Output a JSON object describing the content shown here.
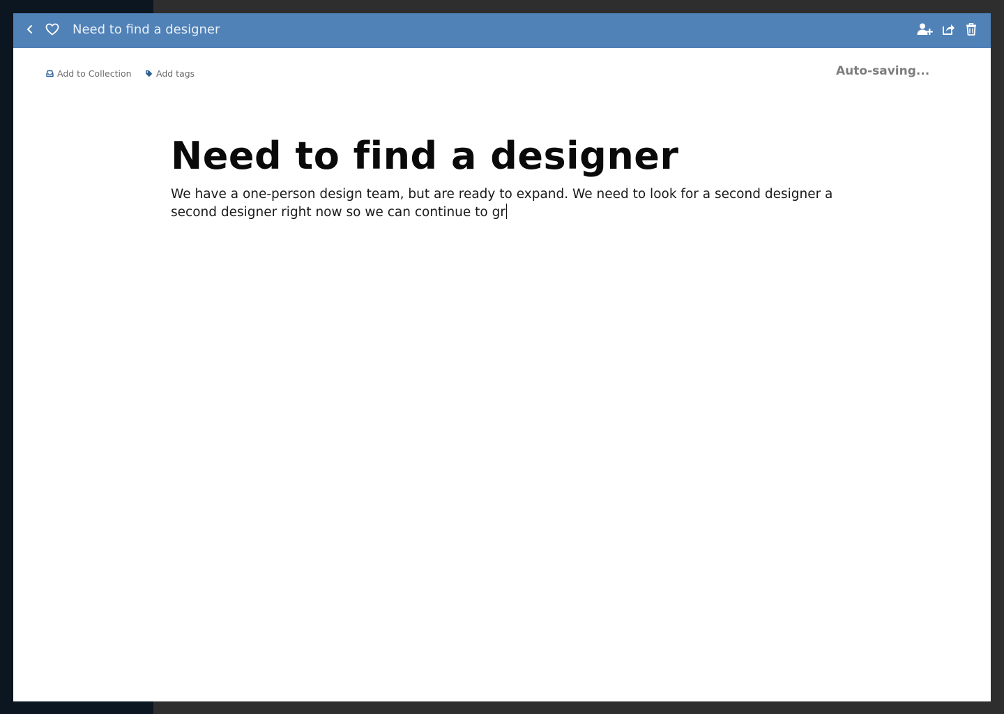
{
  "window": {
    "title": "Need to find a designer"
  },
  "header": {
    "back_icon": "chevron-left-icon",
    "favorite_icon": "heart-outline-icon",
    "add_user_icon": "user-plus-icon",
    "share_icon": "share-icon",
    "delete_icon": "trash-icon",
    "bar_color": "#5081b7"
  },
  "meta": {
    "add_to_collection_label": "Add to Collection",
    "add_tags_label": "Add tags",
    "status_text": "Auto-saving..."
  },
  "document": {
    "title": "Need to find a designer",
    "body": "We have a one-person design team, but are ready to expand. We need to look for a second designer a second designer right now so we can continue to gr"
  }
}
